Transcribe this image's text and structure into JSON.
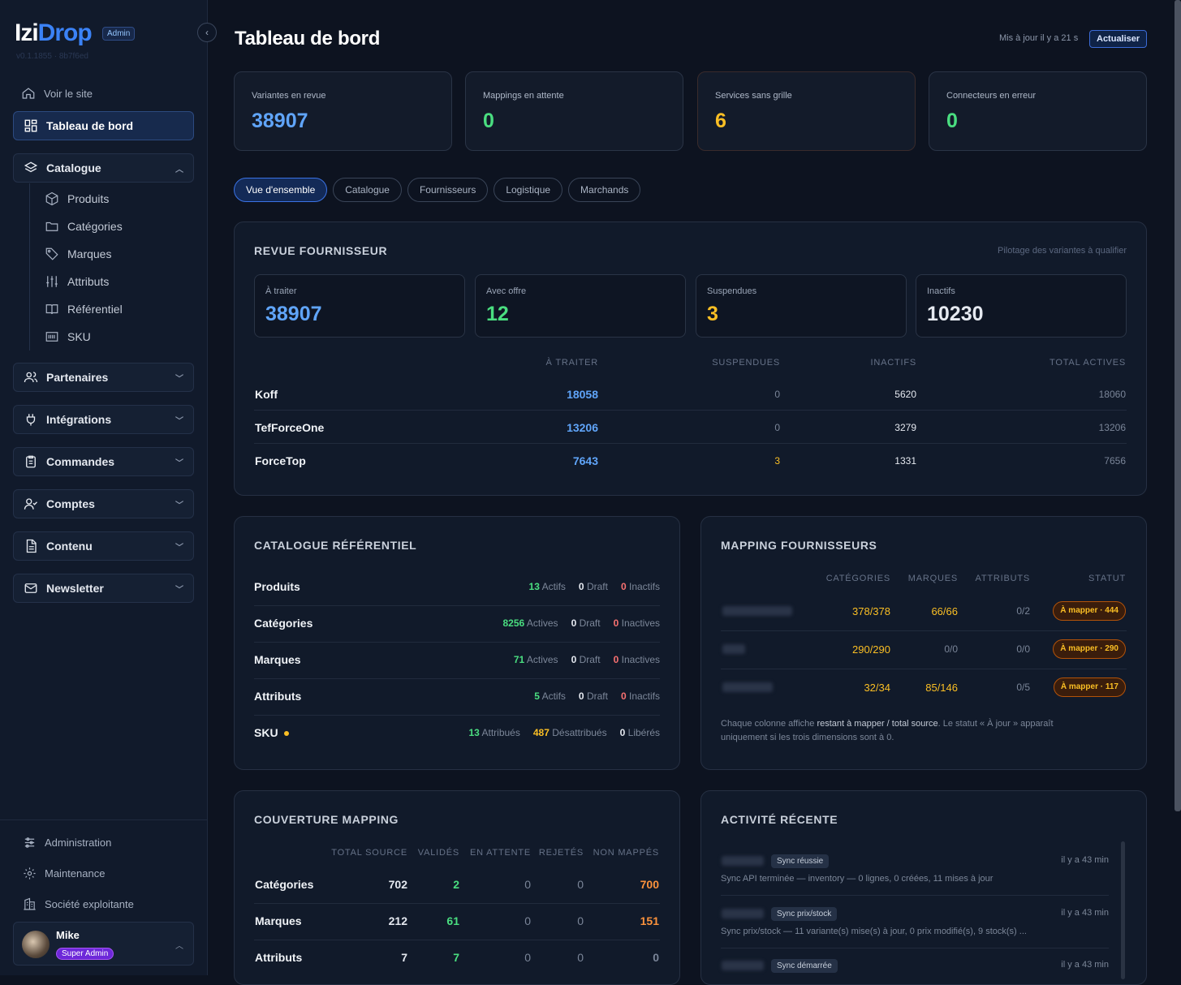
{
  "app": {
    "logo_a": "Izi",
    "logo_b": "Drop",
    "badge": "Admin",
    "version": "v0.1.1855 · 8b7f6ed"
  },
  "sidebar": {
    "view_site": "Voir le site",
    "dashboard": "Tableau de bord",
    "catalogue": "Catalogue",
    "catalogue_items": [
      "Produits",
      "Catégories",
      "Marques",
      "Attributs",
      "Référentiel",
      "SKU"
    ],
    "groups": [
      "Partenaires",
      "Intégrations",
      "Commandes",
      "Comptes",
      "Contenu",
      "Newsletter"
    ],
    "bottom": [
      "Administration",
      "Maintenance",
      "Société exploitante"
    ],
    "user": {
      "name": "Mike",
      "role": "Super Admin"
    }
  },
  "header": {
    "title": "Tableau de bord",
    "updated": "Mis à jour il y a 21 s",
    "refresh": "Actualiser"
  },
  "kpis": [
    {
      "label": "Variantes en revue",
      "value": "38907",
      "color": "#60a5fa"
    },
    {
      "label": "Mappings en attente",
      "value": "0",
      "color": "#4ade80"
    },
    {
      "label": "Services sans grille",
      "value": "6",
      "color": "#fbbf24"
    },
    {
      "label": "Connecteurs en erreur",
      "value": "0",
      "color": "#4ade80"
    }
  ],
  "tabs": [
    "Vue d'ensemble",
    "Catalogue",
    "Fournisseurs",
    "Logistique",
    "Marchands"
  ],
  "revue": {
    "title": "REVUE FOURNISSEUR",
    "subtitle": "Pilotage des variantes à qualifier",
    "minis": [
      {
        "label": "À traiter",
        "value": "38907",
        "color": "#60a5fa"
      },
      {
        "label": "Avec offre",
        "value": "12",
        "color": "#4ade80"
      },
      {
        "label": "Suspendues",
        "value": "3",
        "color": "#fbbf24"
      },
      {
        "label": "Inactifs",
        "value": "10230",
        "color": "#e5e9f0"
      }
    ],
    "headers": [
      "À TRAITER",
      "SUSPENDUES",
      "INACTIFS",
      "TOTAL ACTIVES"
    ],
    "rows": [
      {
        "name": "Koff",
        "a": "18058",
        "s": "0",
        "i": "5620",
        "t": "18060"
      },
      {
        "name": "TefForceOne",
        "a": "13206",
        "s": "0",
        "i": "3279",
        "t": "13206"
      },
      {
        "name": "ForceTop",
        "a": "7643",
        "s": "3",
        "i": "1331",
        "t": "7656"
      }
    ]
  },
  "catalogue_ref": {
    "title": "CATALOGUE RÉFÉRENTIEL",
    "rows": [
      {
        "name": "Produits",
        "n1": "13",
        "l1": "Actifs",
        "n2": "0",
        "l2": "Draft",
        "n3": "0",
        "l3": "Inactifs"
      },
      {
        "name": "Catégories",
        "n1": "8256",
        "l1": "Actives",
        "n2": "0",
        "l2": "Draft",
        "n3": "0",
        "l3": "Inactives"
      },
      {
        "name": "Marques",
        "n1": "71",
        "l1": "Actives",
        "n2": "0",
        "l2": "Draft",
        "n3": "0",
        "l3": "Inactives"
      },
      {
        "name": "Attributs",
        "n1": "5",
        "l1": "Actifs",
        "n2": "0",
        "l2": "Draft",
        "n3": "0",
        "l3": "Inactifs"
      },
      {
        "name": "SKU",
        "n1": "13",
        "l1": "Attribués",
        "n2": "487",
        "l2": "Désattribués",
        "n3": "0",
        "l3": "Libérés"
      }
    ]
  },
  "mapping": {
    "title": "MAPPING FOURNISSEURS",
    "headers": [
      "CATÉGORIES",
      "MARQUES",
      "ATTRIBUTS",
      "STATUT"
    ],
    "rows": [
      {
        "cat": "378/378",
        "mar": "66/66",
        "att": "0/2",
        "status": "À mapper · 444"
      },
      {
        "cat": "290/290",
        "mar": "0/0",
        "att": "0/0",
        "status": "À mapper · 290"
      },
      {
        "cat": "32/34",
        "mar": "85/146",
        "att": "0/5",
        "status": "À mapper · 117"
      }
    ],
    "note_a": "Chaque colonne affiche ",
    "note_b": "restant à mapper / total source",
    "note_c": ". Le statut « À jour » apparaît",
    "note_d": "uniquement si les trois dimensions sont à 0."
  },
  "couverture": {
    "title": "COUVERTURE MAPPING",
    "headers": [
      "TOTAL SOURCE",
      "VALIDÉS",
      "EN ATTENTE",
      "REJETÉS",
      "NON MAPPÉS"
    ],
    "rows": [
      {
        "name": "Catégories",
        "t": "702",
        "v": "2",
        "e": "0",
        "r": "0",
        "n": "700"
      },
      {
        "name": "Marques",
        "t": "212",
        "v": "61",
        "e": "0",
        "r": "0",
        "n": "151"
      },
      {
        "name": "Attributs",
        "t": "7",
        "v": "7",
        "e": "0",
        "r": "0",
        "n": "0"
      }
    ]
  },
  "activite": {
    "title": "ACTIVITÉ RÉCENTE",
    "items": [
      {
        "badge": "Sync réussie",
        "time": "il y a 43 min",
        "desc": "Sync API terminée — inventory — 0 lignes, 0 créées, 11 mises à jour"
      },
      {
        "badge": "Sync prix/stock",
        "time": "il y a 43 min",
        "desc": "Sync prix/stock — 11 variante(s) mise(s) à jour, 0 prix modifié(s), 9 stock(s) ..."
      },
      {
        "badge": "Sync démarrée",
        "time": "il y a 43 min",
        "desc": ""
      }
    ]
  }
}
